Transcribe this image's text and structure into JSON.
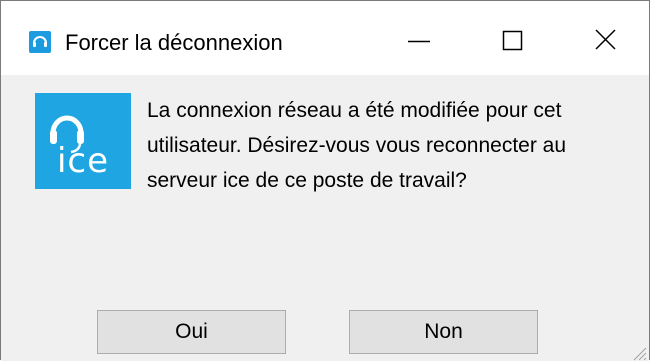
{
  "window": {
    "title": "Forcer la déconnexion",
    "icon": "headset-icon"
  },
  "controls": {
    "minimize": "minimize-icon",
    "maximize": "maximize-icon",
    "close": "close-icon"
  },
  "logo": {
    "text": "ice",
    "icon": "headset-icon",
    "color": "#1fa6e2"
  },
  "message": {
    "line1": "La connexion réseau a été modifiée pour cet",
    "line2": "utilisateur. Désirez-vous vous reconnecter au",
    "line3": "serveur ice de ce poste de travail?"
  },
  "buttons": {
    "yes": "Oui",
    "no": "Non"
  }
}
